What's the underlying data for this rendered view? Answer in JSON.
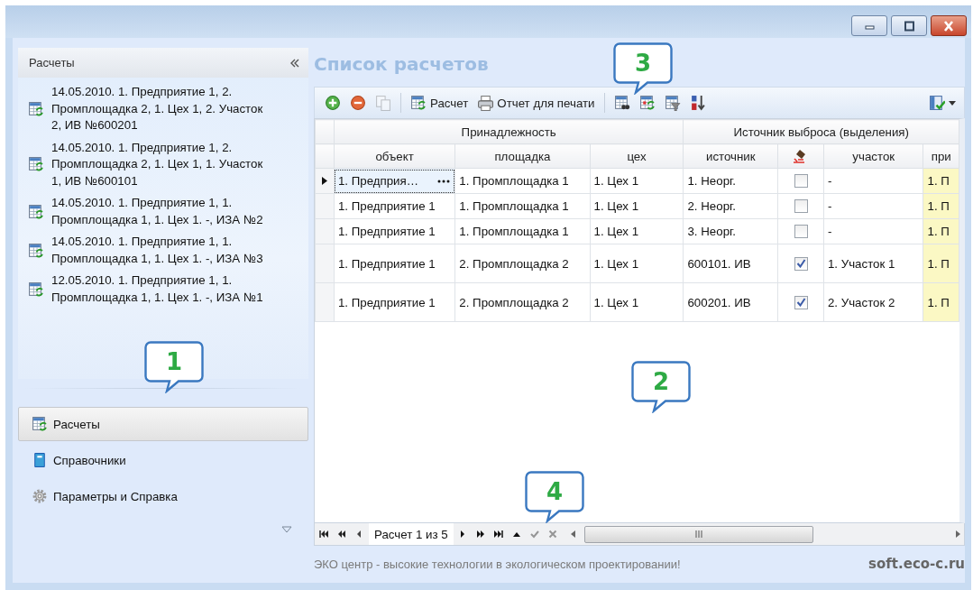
{
  "sidebar": {
    "header": "Расчеты",
    "items": [
      {
        "text": "14.05.2010. 1. Предприятие 1, 2. Промплощадка 2, 1. Цех 1, 2. Участок 2, ИВ №600201"
      },
      {
        "text": "14.05.2010. 1. Предприятие 1, 2. Промплощадка 2, 1. Цех 1, 1. Участок 1, ИВ №600101"
      },
      {
        "text": "14.05.2010. 1. Предприятие 1, 1. Промплощадка 1, 1. Цех 1. -, ИЗА №2"
      },
      {
        "text": "14.05.2010. 1. Предприятие 1, 1. Промплощадка 1, 1. Цех 1. -, ИЗА №3"
      },
      {
        "text": "12.05.2010. 1. Предприятие 1, 1. Промплощадка 1, 1. Цех 1. -, ИЗА №1"
      }
    ],
    "nav": [
      {
        "label": "Расчеты",
        "kind": "calc",
        "selected": true
      },
      {
        "label": "Справочники",
        "kind": "book",
        "selected": false
      },
      {
        "label": "Параметры и Справка",
        "kind": "gear",
        "selected": false
      }
    ]
  },
  "main": {
    "title": "Список расчетов",
    "toolbar": [
      {
        "kind": "add",
        "disabled": false
      },
      {
        "kind": "remove",
        "disabled": false
      },
      {
        "kind": "copy",
        "disabled": true
      },
      {
        "kind": "separator"
      },
      {
        "kind": "calc",
        "label": "Расчет",
        "disabled": false
      },
      {
        "kind": "print",
        "label": "Отчет для печати",
        "disabled": false
      },
      {
        "kind": "separator"
      },
      {
        "kind": "find",
        "disabled": false
      },
      {
        "kind": "refresh",
        "disabled": false
      },
      {
        "kind": "filter",
        "disabled": false
      },
      {
        "kind": "sort",
        "disabled": false
      },
      {
        "kind": "spacer"
      },
      {
        "kind": "layout-menu",
        "disabled": false
      }
    ],
    "grid": {
      "groups": [
        {
          "label": "Принадлежность",
          "columns": [
            {
              "kind": "text",
              "label": "объект",
              "highlighted": false
            },
            {
              "kind": "text",
              "label": "площадка",
              "highlighted": false
            },
            {
              "kind": "text",
              "label": "цех",
              "highlighted": false
            }
          ]
        },
        {
          "label": "Источник выброса (выделения)",
          "columns": [
            {
              "kind": "text",
              "label": "источник",
              "highlighted": false
            },
            {
              "kind": "icon",
              "highlighted": false
            },
            {
              "kind": "text",
              "label": "участок",
              "highlighted": false
            },
            {
              "kind": "text",
              "label": "при",
              "highlighted": true
            }
          ]
        }
      ],
      "rows": [
        {
          "selected": true,
          "checked": false,
          "cells": [
            "1. Предприя…",
            "1. Промплощадка 1",
            "1. Цех 1",
            "1. Неорг.",
            "-",
            "1. П"
          ]
        },
        {
          "selected": false,
          "checked": false,
          "cells": [
            "1. Предприятие 1",
            "1. Промплощадка 1",
            "1. Цех 1",
            "2. Неорг.",
            "-",
            "1. П"
          ]
        },
        {
          "selected": false,
          "checked": false,
          "cells": [
            "1. Предприятие 1",
            "1. Промплощадка 1",
            "1. Цех 1",
            "3. Неорг.",
            "-",
            "1. П"
          ]
        },
        {
          "selected": false,
          "checked": true,
          "cells": [
            "1. Предприятие 1",
            "2. Промплощадка 2",
            "1. Цех 1",
            "600101. ИВ",
            "1. Участок 1",
            "1. П"
          ]
        },
        {
          "selected": false,
          "checked": true,
          "cells": [
            "1. Предприятие 1",
            "2. Промплощадка 2",
            "1. Цех 1",
            "600201. ИВ",
            "2. Участок 2",
            "1. П"
          ]
        }
      ]
    },
    "navigator": {
      "before": [
        {
          "kind": "first",
          "disabled": false
        },
        {
          "kind": "prev-page",
          "disabled": false
        },
        {
          "kind": "prev",
          "disabled": false
        }
      ],
      "record": "Расчет 1 из 5",
      "after": [
        {
          "kind": "next",
          "disabled": false
        },
        {
          "kind": "next-page",
          "disabled": false
        },
        {
          "kind": "last",
          "disabled": false
        },
        {
          "kind": "append",
          "disabled": false
        },
        {
          "kind": "save",
          "disabled": true
        },
        {
          "kind": "cancel",
          "disabled": true
        }
      ]
    }
  },
  "footer": {
    "slogan": "ЭКО центр - высокие технологии в экологическом проектировании!",
    "site": "soft.eco-c.ru"
  },
  "callouts": [
    {
      "text": "3"
    },
    {
      "text": "1"
    },
    {
      "text": "2"
    },
    {
      "text": "4"
    }
  ]
}
